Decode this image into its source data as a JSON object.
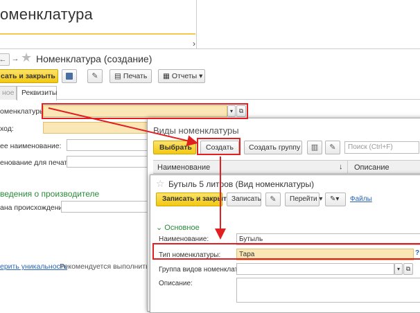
{
  "background_window": {
    "title": "оменклатура",
    "chevron": "›"
  },
  "main_form": {
    "nav_back": "←",
    "nav_forward": "→",
    "title": "Номенклатура (создание)",
    "toolbar": {
      "save_close": "сать и закрыть",
      "print": "Печать",
      "reports": "Отчеты"
    },
    "tabs": {
      "inactive": "ное",
      "active": "Реквизиты"
    },
    "fields": {
      "kind_label": "оменклатуры:",
      "account_label": "ход:",
      "full_name_label": "ее наименование:",
      "print_name_label": "енование для печати:"
    },
    "section_manufacturer": "ведения о производителе",
    "country_label": "ана происхождения:",
    "bottom_link": "ерить уникальность",
    "bottom_hint": "Рекомендуется выполнить пр"
  },
  "kinds_dialog": {
    "title": "Виды номенклатуры",
    "select_button": "Выбрать",
    "create_button": "Создать",
    "create_group_button": "Создать группу",
    "search_placeholder": "Поиск (Ctrl+F)",
    "col_name": "Наименование",
    "sort_arrow": "↓",
    "col_description": "Описание"
  },
  "kind_form": {
    "title": "Бутыль 5 литров (Вид номенклатуры)",
    "save_close": "Записать и закрыть",
    "save": "Записать",
    "goto": "Перейти",
    "files_link": "Файлы",
    "section_main": "Основное",
    "name_label": "Наименование:",
    "name_value": "Бутыль",
    "type_label": "Тип номенклатуры:",
    "type_value": "Тара",
    "help_mark": "?",
    "group_label": "Группа видов номенклатуры:",
    "description_label": "Описание:"
  },
  "colors": {
    "accent_yellow": "#f2c811",
    "highlight_red": "#e02020",
    "section_green": "#2a8a3a",
    "link_blue": "#2b63b7"
  }
}
